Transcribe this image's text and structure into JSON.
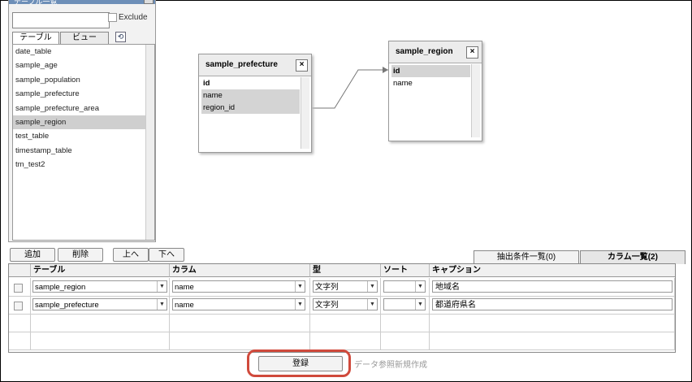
{
  "sidebar": {
    "header_title": "テーブル一覧",
    "search_value": "",
    "exclude_label": "Exclude",
    "tabs": [
      {
        "label": "テーブル"
      },
      {
        "label": "ビュー"
      }
    ],
    "refresh_glyph": "⟲",
    "tables": [
      {
        "name": "date_table"
      },
      {
        "name": "sample_age"
      },
      {
        "name": "sample_population"
      },
      {
        "name": "sample_prefecture"
      },
      {
        "name": "sample_prefecture_area"
      },
      {
        "name": "sample_region"
      },
      {
        "name": "test_table"
      },
      {
        "name": "timestamp_table"
      },
      {
        "name": "tm_test2"
      }
    ],
    "selected_index": 5
  },
  "diagram": {
    "prefecture": {
      "title": "sample_prefecture",
      "close": "×",
      "columns": [
        "id",
        "name",
        "region_id"
      ]
    },
    "region": {
      "title": "sample_region",
      "close": "×",
      "columns": [
        "id",
        "name"
      ]
    }
  },
  "toolbar": {
    "add": "追加",
    "delete": "削除",
    "up": "上へ",
    "down": "下へ"
  },
  "right_tabs": [
    {
      "label": "抽出条件一覧(0)"
    },
    {
      "label": "カラム一覧(2)"
    }
  ],
  "grid": {
    "headers": {
      "table": "テーブル",
      "column": "カラム",
      "type": "型",
      "sort": "ソート",
      "caption": "キャプション"
    },
    "rows": [
      {
        "table": "sample_region",
        "column": "name",
        "type": "文字列",
        "sort": "",
        "caption": "地域名"
      },
      {
        "table": "sample_prefecture",
        "column": "name",
        "type": "文字列",
        "sort": "",
        "caption": "都道府県名"
      }
    ],
    "dropdown_glyph": "▼"
  },
  "footer": {
    "register": "登録",
    "new_ref": "データ参照新規作成"
  },
  "colors": {
    "highlight_ring": "#d04a3c",
    "selection": "#cfcfcf",
    "panel_header": "#6d8fb8"
  }
}
